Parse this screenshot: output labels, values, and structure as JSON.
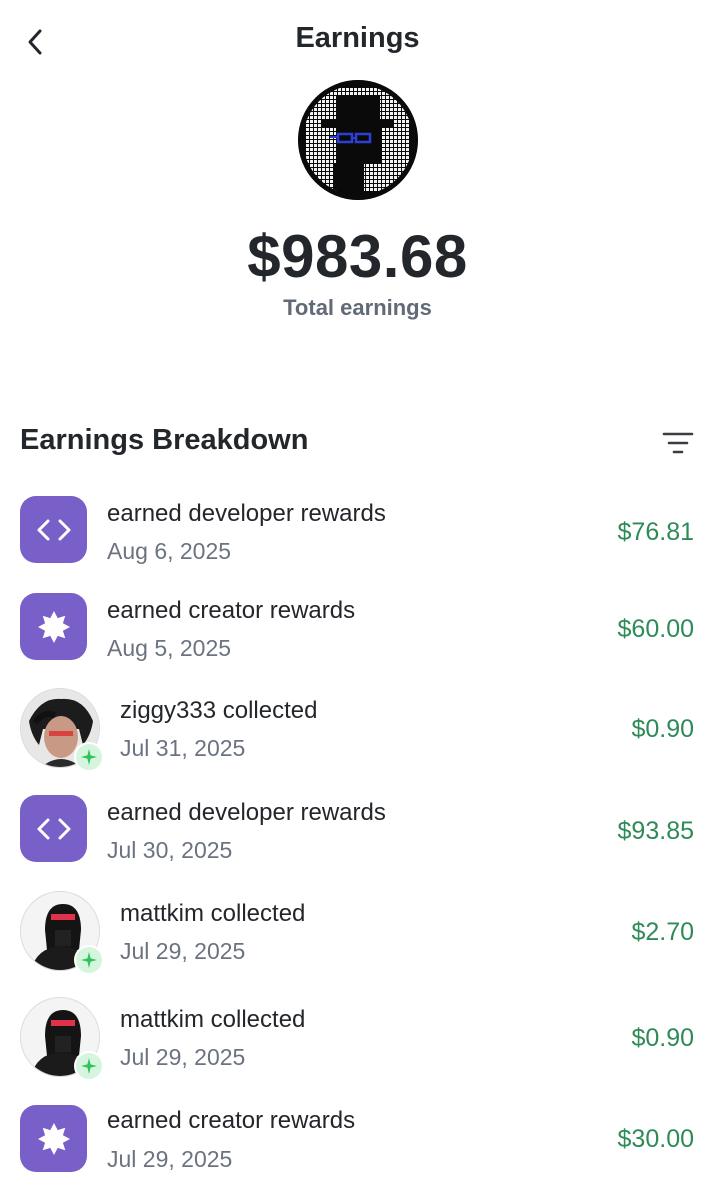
{
  "header": {
    "title": "Earnings",
    "back_icon": "chevron-left-icon"
  },
  "summary": {
    "total": "$983.68",
    "label": "Total earnings"
  },
  "breakdown": {
    "title": "Earnings Breakdown",
    "filter_icon": "filter-icon",
    "items": [
      {
        "type": "developer",
        "icon": "code-icon",
        "title": "earned developer rewards",
        "date": "Aug 6, 2025",
        "amount": "$76.81"
      },
      {
        "type": "creator",
        "icon": "starburst-icon",
        "title": "earned creator rewards",
        "date": "Aug 5, 2025",
        "amount": "$60.00"
      },
      {
        "type": "collect",
        "icon": "avatar",
        "title": "ziggy333 collected",
        "date": "Jul 31, 2025",
        "amount": "$0.90"
      },
      {
        "type": "developer",
        "icon": "code-icon",
        "title": "earned developer rewards",
        "date": "Jul 30, 2025",
        "amount": "$93.85"
      },
      {
        "type": "collect",
        "icon": "avatar",
        "title": "mattkim collected",
        "date": "Jul 29, 2025",
        "amount": "$2.70"
      },
      {
        "type": "collect",
        "icon": "avatar",
        "title": "mattkim collected",
        "date": "Jul 29, 2025",
        "amount": "$0.90"
      },
      {
        "type": "creator",
        "icon": "starburst-icon",
        "title": "earned creator rewards",
        "date": "Jul 29, 2025",
        "amount": "$30.00"
      }
    ]
  },
  "colors": {
    "accent_purple": "#7860c8",
    "amount_green": "#2e8b57",
    "badge_green": "#2fc45a"
  }
}
